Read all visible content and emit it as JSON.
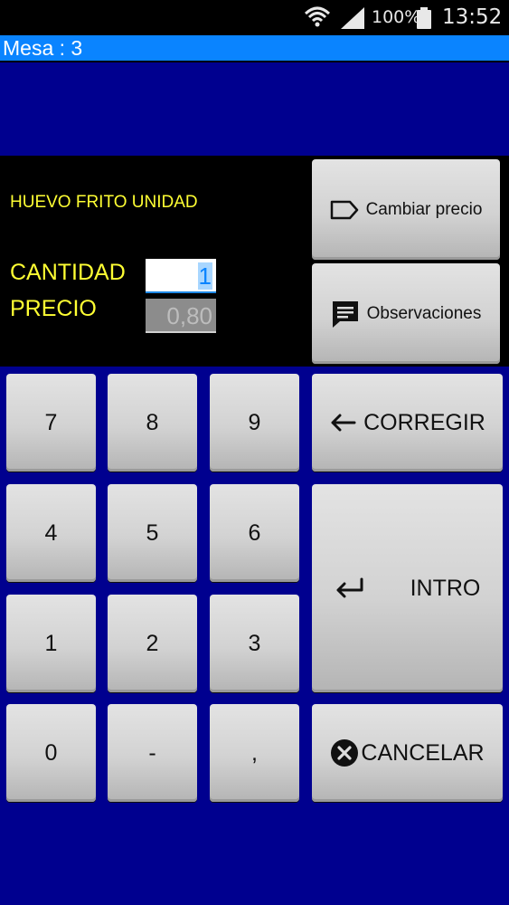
{
  "status_bar": {
    "battery": "100%",
    "time": "13:52"
  },
  "title": "Mesa : 3",
  "product": {
    "name": "HUEVO FRITO UNIDAD"
  },
  "fields": {
    "cantidad_label": "CANTIDAD",
    "cantidad_value": "1",
    "precio_label": "PRECIO",
    "precio_value": "0,80"
  },
  "side_buttons": {
    "cambiar_precio": "Cambiar precio",
    "observaciones": "Observaciones"
  },
  "keypad": {
    "k7": "7",
    "k8": "8",
    "k9": "9",
    "k4": "4",
    "k5": "5",
    "k6": "6",
    "k1": "1",
    "k2": "2",
    "k3": "3",
    "k0": "0",
    "kminus": "-",
    "kcomma": ",",
    "corregir": "CORREGIR",
    "intro": "INTRO",
    "cancelar": "CANCELAR"
  },
  "colors": {
    "title_bar": "#0a84ff",
    "panel_blue": "#00008f",
    "label_yellow": "#ffff33"
  },
  "icons": [
    "wifi-icon",
    "signal-icon",
    "battery-icon",
    "tag-icon",
    "comment-icon",
    "arrow-left-icon",
    "enter-icon",
    "cancel-circle-icon"
  ]
}
